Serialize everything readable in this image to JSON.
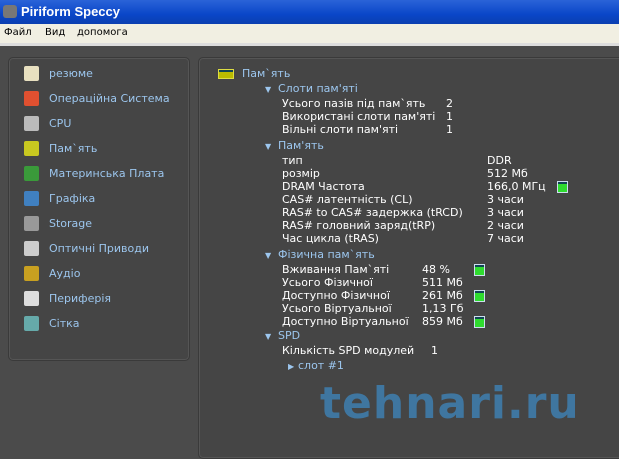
{
  "window": {
    "title": "Piriform Speccy"
  },
  "menu": [
    "Файл",
    "Вид",
    "допомога"
  ],
  "sidebar": [
    {
      "label": "резюме",
      "icon": "summary-icon"
    },
    {
      "label": "Операційна Система",
      "icon": "windows-icon"
    },
    {
      "label": "CPU",
      "icon": "cpu-icon"
    },
    {
      "label": "Пам`ять",
      "icon": "ram-icon"
    },
    {
      "label": "Материнська Плата",
      "icon": "motherboard-icon"
    },
    {
      "label": "Графіка",
      "icon": "monitor-icon"
    },
    {
      "label": "Storage",
      "icon": "hdd-icon"
    },
    {
      "label": "Оптичні Приводи",
      "icon": "optical-icon"
    },
    {
      "label": "Аудіо",
      "icon": "speaker-icon"
    },
    {
      "label": "Периферія",
      "icon": "mouse-icon"
    },
    {
      "label": "Сітка",
      "icon": "network-icon"
    }
  ],
  "main": {
    "title": "Пам`ять",
    "slots": {
      "title": "Слоти пам'яті",
      "rows": [
        [
          "Усього пазів під пам`ять",
          "2"
        ],
        [
          "Використані слоти пам'яті",
          "1"
        ],
        [
          "Вільні слоти пам'яті",
          "1"
        ]
      ]
    },
    "memory": {
      "title": "Пам'ять",
      "rows": [
        [
          "тип",
          "DDR"
        ],
        [
          "розмір",
          "512 Мб"
        ],
        [
          "DRAM Частота",
          "166,0 МГц"
        ],
        [
          "CAS# латентність (CL)",
          "3 часи"
        ],
        [
          "RAS# to CAS# задержка (tRCD)",
          "3 часи"
        ],
        [
          "RAS# головний заряд(tRP)",
          "2 часи"
        ],
        [
          "Час цикла (tRAS)",
          "7 часи"
        ]
      ]
    },
    "physical": {
      "title": "Фізична пам`ять",
      "rows": [
        [
          "Вживання Пам`яті",
          "48 %"
        ],
        [
          "Усього Фізичної",
          "511 Мб"
        ],
        [
          "Доступно Фізичної",
          "261 Мб"
        ],
        [
          "Усього Віртуальної",
          "1,13 Гб"
        ],
        [
          "Доступно Віртуальної",
          "859 Мб"
        ]
      ]
    },
    "spd": {
      "title": "SPD",
      "rows": [
        [
          "Кількість SPD модулей",
          "1"
        ]
      ],
      "slot": "слот #1"
    }
  },
  "watermark": "tehnari.ru"
}
